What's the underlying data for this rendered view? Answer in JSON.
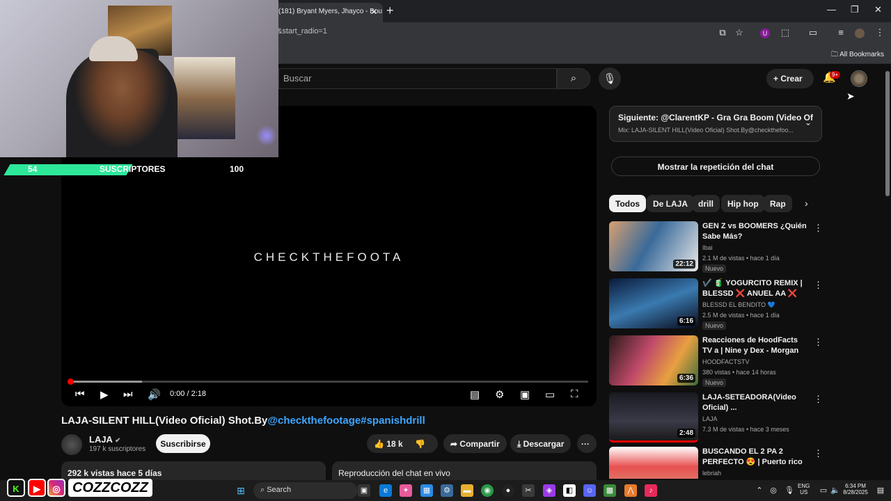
{
  "browser": {
    "tab_title": "(181) Bryant Myers, Jhayco - Bou",
    "tab_close": "✕",
    "new_tab": "+",
    "url_fragment": "&start_radio=1",
    "bookmarks_label": "All Bookmarks",
    "extension_badge": "U"
  },
  "youtube_header": {
    "search_placeholder": "Buscar",
    "create_label": "Crear",
    "notifications_count": "9+"
  },
  "stream_overlay": {
    "subs_current": "54",
    "subs_label": "SUSCRIPTORES",
    "subs_goal": "100",
    "progress_fraction": 0.54,
    "brand_name": "COZZCOZZ"
  },
  "player": {
    "watermark": "CHECKTHEFOOTA",
    "time": "0:00 / 2:18",
    "progress_fraction": 0.0,
    "loaded_fraction": 0.14
  },
  "video": {
    "title_plain": "LAJA-SILENT HILL(Video Oficial) Shot.By",
    "title_links": "@checkthefootage#spanishdrill",
    "channel_name": "LAJA",
    "channel_subs": "197 k suscriptores",
    "subscribe_label": "Suscribirse",
    "likes": "18 k",
    "share_label": "Compartir",
    "download_label": "Descargar",
    "more_label": "···",
    "desc_summary": "292 k vistas  hace 5 días",
    "chat_box_label": "Reproducción del chat en vivo"
  },
  "sidebar": {
    "next_title": "Siguiente: @ClarentKP - Gra Gra Boom (Video Ofici...",
    "next_mix": "Mix: LAJA-SILENT HILL(Video Oficial) Shot.By@checkthefoo...",
    "chat_replay_label": "Mostrar la repetición del chat",
    "chips": [
      "Todos",
      "De LAJA",
      "drill",
      "Hip hop",
      "Rap"
    ],
    "recommendations": [
      {
        "title": "GEN Z vs BOOMERS ¿Quién Sabe Más?",
        "channel": "Ibai",
        "meta": "2.1 M de vistas • hace 1 día",
        "badge": "Nuevo",
        "duration": "22:12"
      },
      {
        "title": "✔️ 🧃 YOGURCITO REMIX | BLESSD ❌ ANUEL AA ❌ YA...",
        "channel": "BLESSD EL BENDITO 💙",
        "meta": "2.5 M de vistas • hace 1 día",
        "badge": "Nuevo",
        "duration": "6:16"
      },
      {
        "title": "Reacciones de HoodFacts TV a | Nine y Dex - Morgan Freeman",
        "channel": "HOODFACTSTV",
        "meta": "380 vistas • hace 14 horas",
        "badge": "Nuevo",
        "duration": "6:36"
      },
      {
        "title": "LAJA-SETEADORA(Video Oficial) ...",
        "channel": "LAJA",
        "meta": "7.3 M de vistas • hace 3 meses",
        "badge": "",
        "duration": "2:48"
      },
      {
        "title": "BUSCANDO EL 2 PA 2 PERFECTO 😍 | Puerto rico",
        "channel": "lebriah",
        "meta": "",
        "badge": "",
        "duration": ""
      }
    ]
  },
  "taskbar": {
    "search_label": "Search",
    "lang": "ENG",
    "region": "US",
    "time": "6:34 PM",
    "date": "8/28/2025"
  }
}
